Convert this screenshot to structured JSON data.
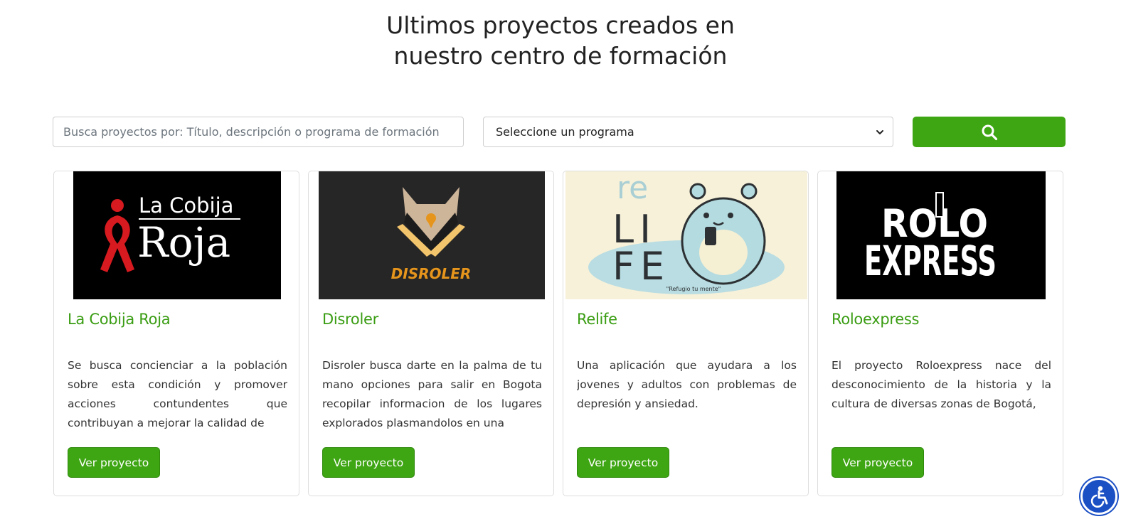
{
  "heading": {
    "line1": "Ultimos proyectos creados en",
    "line2": "nuestro centro de formación"
  },
  "search": {
    "placeholder": "Busca proyectos por: Título, descripción o programa de formación",
    "value": ""
  },
  "program_select": {
    "selected": "Seleccione un programa"
  },
  "search_button": {
    "icon": "search-icon"
  },
  "colors": {
    "accent": "#3ea513",
    "title_green": "#3a9d13"
  },
  "projects": [
    {
      "title": "La Cobija Roja",
      "description": "Se busca concienciar a la población sobre esta condición y promover acciones contundentes que contribuyan a mejorar la calidad de",
      "button": "Ver proyecto",
      "logo": {
        "line1": "La Cobija",
        "line2": "Roja"
      }
    },
    {
      "title": "Disroler",
      "description": "Disroler busca darte en la palma de tu mano opciones para salir en Bogota recopilar informacion de los lugares explorados plasmandolos en una",
      "button": "Ver proyecto",
      "logo": {
        "text": "DISROLER"
      }
    },
    {
      "title": "Relife",
      "description": "Una aplicación que ayudara a los jovenes y adultos con problemas de depresión y ansiedad.",
      "button": "Ver proyecto",
      "logo": {
        "re": "re",
        "li": "LI",
        "fe": "FE",
        "tagline": "\"Refugio tu mente\""
      }
    },
    {
      "title": "Roloexpress",
      "description": "El proyecto Roloexpress nace del desconocimiento de la historia y la cultura de diversas zonas de Bogotá,",
      "button": "Ver proyecto",
      "logo": {
        "line1": "ROLO",
        "line2": "EXPRESS"
      }
    }
  ],
  "accessibility_button": {
    "icon": "accessibility-icon"
  }
}
